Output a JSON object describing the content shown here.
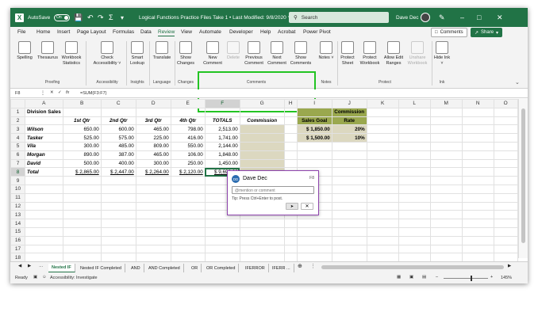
{
  "titlebar": {
    "autosave_label": "AutoSave",
    "autosave_state": "On",
    "title": "Logical Functions Practice Files Take 1 • Last Modified: 9/8/2020 ∨",
    "search_placeholder": "Search",
    "user": "Dave Dec"
  },
  "menu": {
    "tabs": [
      "File",
      "Home",
      "Insert",
      "Page Layout",
      "Formulas",
      "Data",
      "Review",
      "View",
      "Automate",
      "Developer",
      "Help",
      "Acrobat",
      "Power Pivot"
    ],
    "comments_button": "Comments",
    "share_button": "Share"
  },
  "ribbon": {
    "proofing": {
      "spelling": "Spelling",
      "thesaurus": "Thesaurus",
      "workbook_statistics": "Workbook Statistics",
      "label": "Proofing"
    },
    "accessibility": {
      "check": "Check Accessibility ˅",
      "label": "Accessibility"
    },
    "insights": {
      "smart_lookup": "Smart Lookup",
      "label": "Insights"
    },
    "language": {
      "translate": "Translate",
      "label": "Language"
    },
    "changes": {
      "show_changes": "Show Changes",
      "label": "Changes"
    },
    "comments": {
      "new": "New Comment",
      "delete": "Delete",
      "previous": "Previous Comment",
      "next": "Next Comment",
      "show": "Show Comments",
      "label": "Comments"
    },
    "notes": {
      "notes": "Notes ˅",
      "label": "Notes"
    },
    "protect": {
      "sheet": "Protect Sheet",
      "workbook": "Protect Workbook",
      "allow_edit": "Allow Edit Ranges",
      "unshare": "Unshare Workbook",
      "label": "Protect"
    },
    "ink": {
      "hide_ink": "Hide Ink ˅",
      "label": "Ink"
    }
  },
  "formula_bar": {
    "cell_ref": "F8",
    "fx": "fx",
    "formula": "=SUM(F3:F7)"
  },
  "columns": [
    "A",
    "B",
    "C",
    "D",
    "E",
    "F",
    "G",
    "H",
    "I",
    "J",
    "K",
    "L",
    "M",
    "N",
    "O"
  ],
  "rows": [
    [
      "Division Sales",
      "",
      "",
      "",
      "",
      "",
      "",
      "",
      "",
      "Commission",
      "",
      "",
      "",
      "",
      ""
    ],
    [
      "",
      "1st Qtr",
      "2nd Qtr",
      "3rd Qtr",
      "4th Qtr",
      "TOTALS",
      "Commission",
      "",
      "Sales Goal",
      "Rate",
      "",
      "",
      "",
      "",
      ""
    ],
    [
      "Wilson",
      "650.00",
      "600.00",
      "465.00",
      "798.00",
      "2,513.00",
      "",
      "",
      "$ 1,850.00",
      "20%",
      "",
      "",
      "",
      "",
      ""
    ],
    [
      "Tasker",
      "525.00",
      "575.00",
      "225.00",
      "416.00",
      "1,741.00",
      "",
      "",
      "$ 1,500.00",
      "10%",
      "",
      "",
      "",
      "",
      ""
    ],
    [
      "Vila",
      "300.00",
      "485.00",
      "809.00",
      "550.00",
      "2,144.00",
      "",
      "",
      "",
      "",
      "",
      "",
      "",
      "",
      ""
    ],
    [
      "Morgan",
      "890.00",
      "387.00",
      "465.00",
      "106.00",
      "1,848.00",
      "",
      "",
      "",
      "",
      "",
      "",
      "",
      "",
      ""
    ],
    [
      "David",
      "500.00",
      "400.00",
      "300.00",
      "250.00",
      "1,450.00",
      "",
      "",
      "",
      "",
      "",
      "",
      "",
      "",
      ""
    ],
    [
      "Total",
      "$ 2,865.00",
      "$ 2,447.00",
      "$ 2,264.00",
      "$ 2,120.00",
      "$ 9,696.00",
      "",
      "",
      "",
      "",
      "",
      "",
      "",
      "",
      ""
    ],
    [
      "",
      "",
      "",
      "",
      "",
      "",
      "",
      "",
      "",
      "",
      "",
      "",
      "",
      "",
      ""
    ],
    [
      "",
      "",
      "",
      "",
      "",
      "",
      "",
      "",
      "",
      "",
      "",
      "",
      "",
      "",
      ""
    ],
    [
      "",
      "",
      "",
      "",
      "",
      "",
      "",
      "",
      "",
      "",
      "",
      "",
      "",
      "",
      ""
    ],
    [
      "",
      "",
      "",
      "",
      "",
      "",
      "",
      "",
      "",
      "",
      "",
      "",
      "",
      "",
      ""
    ],
    [
      "",
      "",
      "",
      "",
      "",
      "",
      "",
      "",
      "",
      "",
      "",
      "",
      "",
      "",
      ""
    ],
    [
      "",
      "",
      "",
      "",
      "",
      "",
      "",
      "",
      "",
      "",
      "",
      "",
      "",
      "",
      ""
    ],
    [
      "",
      "",
      "",
      "",
      "",
      "",
      "",
      "",
      "",
      "",
      "",
      "",
      "",
      "",
      ""
    ],
    [
      "",
      "",
      "",
      "",
      "",
      "",
      "",
      "",
      "",
      "",
      "",
      "",
      "",
      "",
      ""
    ],
    [
      "",
      "",
      "",
      "",
      "",
      "",
      "",
      "",
      "",
      "",
      "",
      "",
      "",
      "",
      ""
    ],
    [
      "",
      "",
      "",
      "",
      "",
      "",
      "",
      "",
      "",
      "",
      "",
      "",
      "",
      "",
      ""
    ]
  ],
  "comment_card": {
    "initials": "DD",
    "author": "Dave Dec",
    "cell": "F8",
    "placeholder": "@mention or comment",
    "tip": "Tip: Press Ctrl+Enter to post."
  },
  "sheet_tabs": [
    "Nested IF",
    "Nested IF Completed",
    "AND",
    "AND Completed",
    "OR",
    "OR Completed",
    "IFERROR",
    "IFERR ..."
  ],
  "status": {
    "ready": "Ready",
    "accessibility": "Accessibility: Investigate",
    "zoom": "145%"
  }
}
